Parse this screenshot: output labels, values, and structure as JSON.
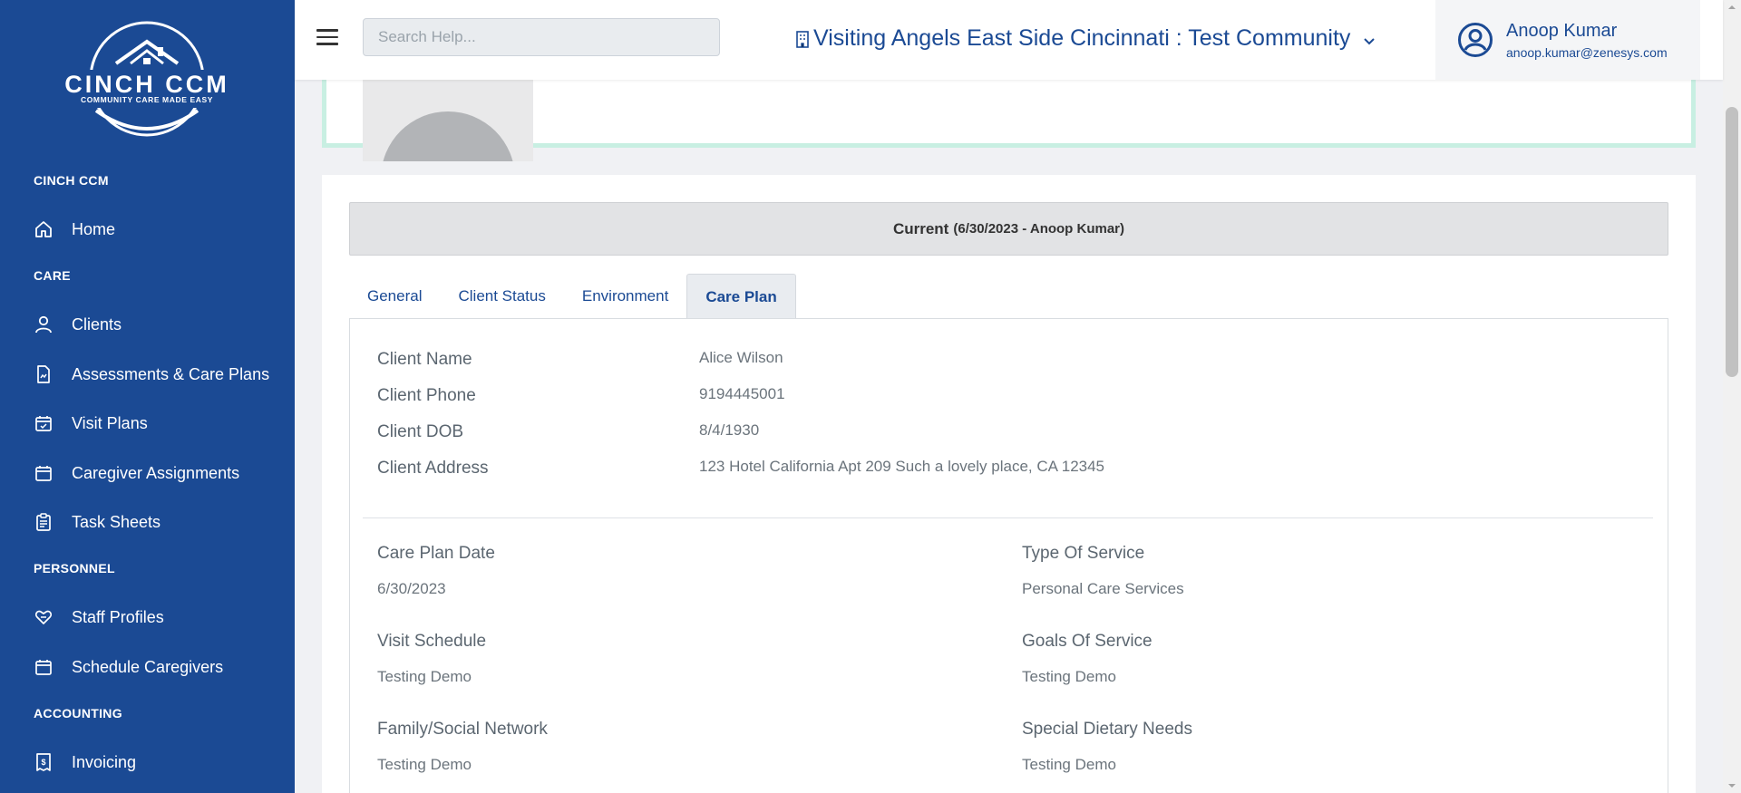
{
  "sidebar": {
    "logo": {
      "name": "CINCH CCM",
      "tagline": "COMMUNITY CARE MADE EASY"
    },
    "sections": [
      {
        "title": "CINCH CCM"
      },
      {
        "title": "CARE"
      },
      {
        "title": "PERSONNEL"
      },
      {
        "title": "ACCOUNTING"
      }
    ],
    "items": [
      {
        "label": "Home",
        "icon": "home-icon"
      },
      {
        "label": "Clients",
        "icon": "user-icon"
      },
      {
        "label": "Assessments & Care Plans",
        "icon": "document-chart-icon"
      },
      {
        "label": "Visit Plans",
        "icon": "calendar-plan-icon"
      },
      {
        "label": "Caregiver Assignments",
        "icon": "calendar-icon"
      },
      {
        "label": "Task Sheets",
        "icon": "clipboard-icon"
      },
      {
        "label": "Staff Profiles",
        "icon": "heart-hand-icon"
      },
      {
        "label": "Schedule Caregivers",
        "icon": "calendar-icon"
      },
      {
        "label": "Invoicing",
        "icon": "invoice-icon"
      }
    ]
  },
  "header": {
    "search_placeholder": "Search Help...",
    "community": "Visiting Angels East Side Cincinnati : Test Community",
    "user": {
      "name": "Anoop Kumar",
      "email": "anoop.kumar@zenesys.com"
    }
  },
  "current": {
    "label": "Current",
    "detail": "(6/30/2023 - Anoop Kumar)"
  },
  "tabs": [
    {
      "label": "General"
    },
    {
      "label": "Client Status"
    },
    {
      "label": "Environment"
    },
    {
      "label": "Care Plan"
    }
  ],
  "client": {
    "rows": [
      {
        "key": "Client Name",
        "value": "Alice Wilson"
      },
      {
        "key": "Client Phone",
        "value": "9194445001"
      },
      {
        "key": "Client DOB",
        "value": "8/4/1930"
      },
      {
        "key": "Client Address",
        "value": "123 Hotel California Apt 209 Such a lovely place, CA 12345"
      }
    ]
  },
  "care_plan": {
    "fields": [
      {
        "label": "Care Plan Date",
        "value": "6/30/2023"
      },
      {
        "label": "Type Of Service",
        "value": "Personal Care Services"
      },
      {
        "label": "Visit Schedule",
        "value": "Testing Demo"
      },
      {
        "label": "Goals Of Service",
        "value": "Testing Demo"
      },
      {
        "label": "Family/Social Network",
        "value": "Testing Demo"
      },
      {
        "label": "Special Dietary Needs",
        "value": "Testing Demo"
      }
    ]
  },
  "colors": {
    "brand": "#1b4a94",
    "accent_border": "#c8efe2"
  }
}
